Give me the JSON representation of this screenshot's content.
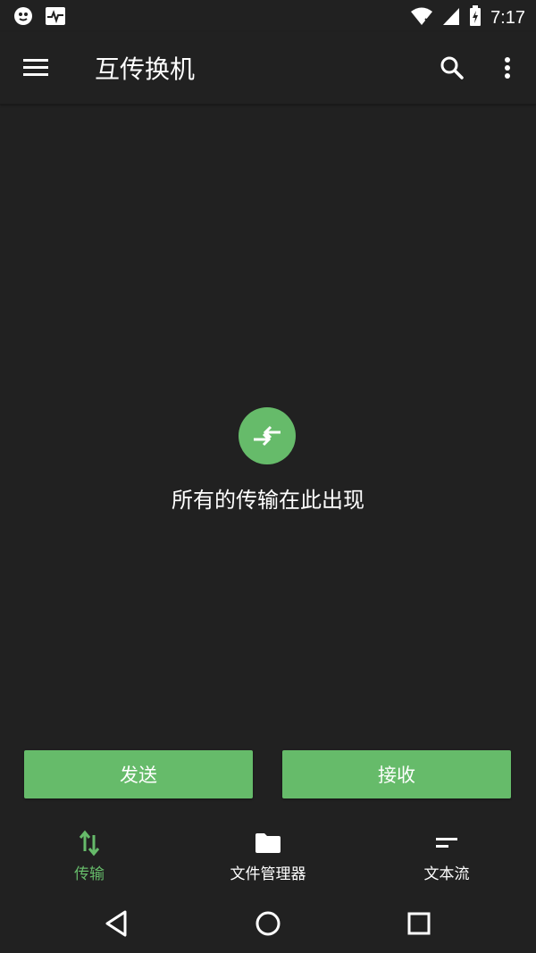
{
  "app": {
    "title": "互传换机"
  },
  "status": {
    "time": "7:17"
  },
  "empty_state": {
    "message": "所有的传输在此出现"
  },
  "actions": {
    "send_label": "发送",
    "receive_label": "接收"
  },
  "bottom_nav": {
    "items": [
      {
        "label": "传输",
        "icon": "transfer-icon",
        "active": true
      },
      {
        "label": "文件管理器",
        "icon": "folder-icon",
        "active": false
      },
      {
        "label": "文本流",
        "icon": "text-stream-icon",
        "active": false
      }
    ]
  },
  "colors": {
    "accent": "#66bb6a",
    "background": "#212121"
  }
}
